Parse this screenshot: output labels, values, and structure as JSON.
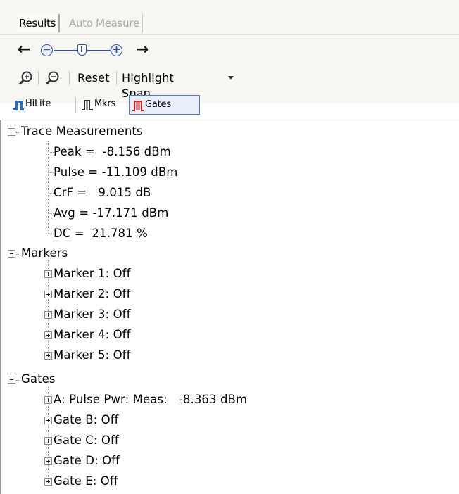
{
  "tabs": [
    {
      "label": "Results",
      "active": true
    },
    {
      "label": "Auto Measure",
      "active": false
    }
  ],
  "toolbar": {
    "reset_label": "Reset",
    "highlight_label": "Highlight Span",
    "toggles": [
      {
        "label": "HiLite",
        "icon": "hilite-icon",
        "pressed": false
      },
      {
        "label": "Mkrs",
        "icon": "markers-icon",
        "pressed": false
      },
      {
        "label": "Gates",
        "icon": "gates-icon",
        "pressed": true
      }
    ]
  },
  "tree": {
    "trace": {
      "label": "Trace Measurements",
      "items": [
        "Peak =  -8.156 dBm",
        "Pulse = -11.109 dBm",
        "CrF =   9.015 dB",
        "Avg = -17.171 dBm",
        "DC =  21.781 %"
      ]
    },
    "markers": {
      "label": "Markers",
      "items": [
        "Marker 1: Off",
        "Marker 2: Off",
        "Marker 3: Off",
        "Marker 4: Off",
        "Marker 5: Off"
      ]
    },
    "gates": {
      "label": "Gates",
      "items": [
        "A: Pulse Pwr: Meas:   -8.363 dBm",
        "Gate B: Off",
        "Gate C: Off",
        "Gate D: Off",
        "Gate E: Off"
      ]
    }
  },
  "colors": {
    "accent": "#2d4fb0",
    "hilite": "#1a6fd1",
    "gates_icon": "#d02020",
    "pressed_border": "#5a76c8",
    "toolbar_bg": "#f7f6f2"
  }
}
